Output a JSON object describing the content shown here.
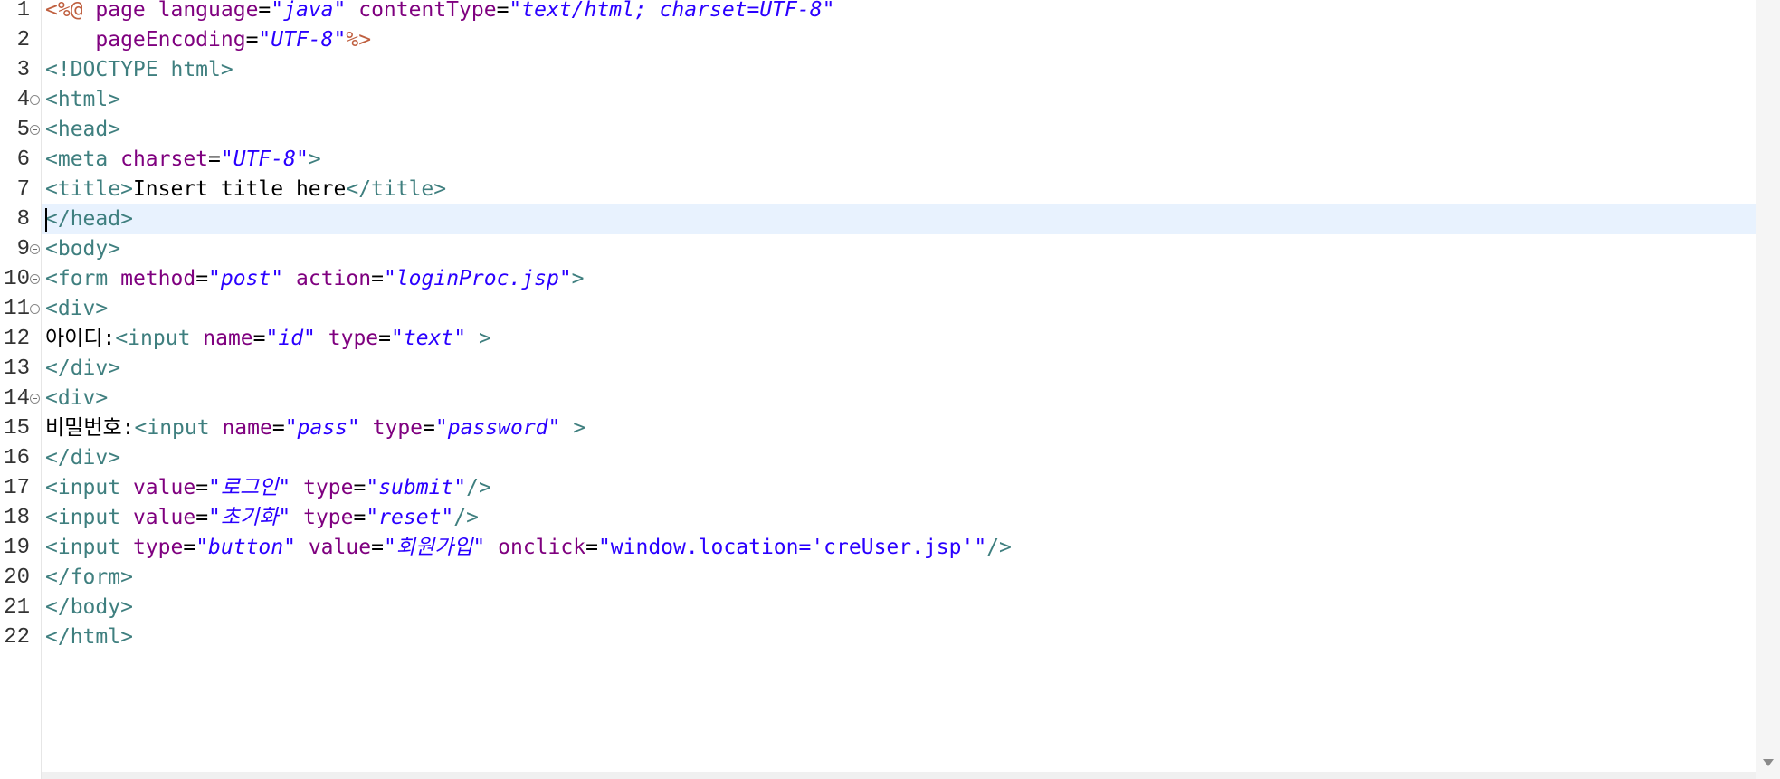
{
  "editor": {
    "current_line": 8,
    "lines": [
      {
        "n": "1",
        "fold": false,
        "tokens": [
          [
            "jsp",
            "<%@ "
          ],
          [
            "attr",
            "page "
          ],
          [
            "attr",
            "language"
          ],
          [
            "text",
            "="
          ],
          [
            "str",
            "\"java\""
          ],
          [
            "text",
            " "
          ],
          [
            "attr",
            "contentType"
          ],
          [
            "text",
            "="
          ],
          [
            "str",
            "\"text/html; charset=UTF-8\""
          ]
        ]
      },
      {
        "n": "2",
        "fold": false,
        "tokens": [
          [
            "text",
            "    "
          ],
          [
            "attr",
            "pageEncoding"
          ],
          [
            "text",
            "="
          ],
          [
            "str",
            "\"UTF-8\""
          ],
          [
            "jsp",
            "%>"
          ]
        ]
      },
      {
        "n": "3",
        "fold": false,
        "tokens": [
          [
            "tag",
            "<!DOCTYPE html>"
          ]
        ]
      },
      {
        "n": "4",
        "fold": true,
        "tokens": [
          [
            "tag",
            "<html>"
          ]
        ]
      },
      {
        "n": "5",
        "fold": true,
        "tokens": [
          [
            "tag",
            "<head>"
          ]
        ]
      },
      {
        "n": "6",
        "fold": false,
        "tokens": [
          [
            "tag",
            "<meta "
          ],
          [
            "attr",
            "charset"
          ],
          [
            "text",
            "="
          ],
          [
            "str",
            "\"UTF-8\""
          ],
          [
            "tag",
            ">"
          ]
        ]
      },
      {
        "n": "7",
        "fold": false,
        "tokens": [
          [
            "tag",
            "<title>"
          ],
          [
            "text",
            "Insert title here"
          ],
          [
            "tag",
            "</title>"
          ]
        ]
      },
      {
        "n": "8",
        "fold": false,
        "tokens": [
          [
            "tag",
            "</head>"
          ]
        ]
      },
      {
        "n": "9",
        "fold": true,
        "tokens": [
          [
            "tag",
            "<body>"
          ]
        ]
      },
      {
        "n": "10",
        "fold": true,
        "tokens": [
          [
            "tag",
            "<form "
          ],
          [
            "attr",
            "method"
          ],
          [
            "text",
            "="
          ],
          [
            "str",
            "\"post\""
          ],
          [
            "text",
            " "
          ],
          [
            "attr",
            "action"
          ],
          [
            "text",
            "="
          ],
          [
            "str",
            "\"loginProc.jsp\""
          ],
          [
            "tag",
            ">"
          ]
        ]
      },
      {
        "n": "11",
        "fold": true,
        "tokens": [
          [
            "tag",
            "<div>"
          ]
        ]
      },
      {
        "n": "12",
        "fold": false,
        "tokens": [
          [
            "text",
            "아이디:"
          ],
          [
            "tag",
            "<input "
          ],
          [
            "attr",
            "name"
          ],
          [
            "text",
            "="
          ],
          [
            "str",
            "\"id\""
          ],
          [
            "text",
            " "
          ],
          [
            "attr",
            "type"
          ],
          [
            "text",
            "="
          ],
          [
            "str",
            "\"text\""
          ],
          [
            "text",
            " "
          ],
          [
            "tag",
            ">"
          ]
        ]
      },
      {
        "n": "13",
        "fold": false,
        "tokens": [
          [
            "tag",
            "</div>"
          ]
        ]
      },
      {
        "n": "14",
        "fold": true,
        "tokens": [
          [
            "tag",
            "<div>"
          ]
        ]
      },
      {
        "n": "15",
        "fold": false,
        "tokens": [
          [
            "text",
            "비밀번호:"
          ],
          [
            "tag",
            "<input "
          ],
          [
            "attr",
            "name"
          ],
          [
            "text",
            "="
          ],
          [
            "str",
            "\"pass\""
          ],
          [
            "text",
            " "
          ],
          [
            "attr",
            "type"
          ],
          [
            "text",
            "="
          ],
          [
            "str",
            "\"password\""
          ],
          [
            "text",
            " "
          ],
          [
            "tag",
            ">"
          ]
        ]
      },
      {
        "n": "16",
        "fold": false,
        "tokens": [
          [
            "tag",
            "</div>"
          ]
        ]
      },
      {
        "n": "17",
        "fold": false,
        "tokens": [
          [
            "tag",
            "<input "
          ],
          [
            "attr",
            "value"
          ],
          [
            "text",
            "="
          ],
          [
            "str",
            "\"로그인\""
          ],
          [
            "text",
            " "
          ],
          [
            "attr",
            "type"
          ],
          [
            "text",
            "="
          ],
          [
            "str",
            "\"submit\""
          ],
          [
            "tag",
            "/>"
          ]
        ]
      },
      {
        "n": "18",
        "fold": false,
        "tokens": [
          [
            "tag",
            "<input "
          ],
          [
            "attr",
            "value"
          ],
          [
            "text",
            "="
          ],
          [
            "str",
            "\"초기화\""
          ],
          [
            "text",
            " "
          ],
          [
            "attr",
            "type"
          ],
          [
            "text",
            "="
          ],
          [
            "str",
            "\"reset\""
          ],
          [
            "tag",
            "/>"
          ]
        ]
      },
      {
        "n": "19",
        "fold": false,
        "tokens": [
          [
            "tag",
            "<input "
          ],
          [
            "attr",
            "type"
          ],
          [
            "text",
            "="
          ],
          [
            "str",
            "\"button\""
          ],
          [
            "text",
            " "
          ],
          [
            "attr",
            "value"
          ],
          [
            "text",
            "="
          ],
          [
            "str",
            "\"회원가입\""
          ],
          [
            "text",
            " "
          ],
          [
            "attr",
            "onclick"
          ],
          [
            "text",
            "="
          ],
          [
            "jsstr",
            "\"window.location='creUser.jsp'\""
          ],
          [
            "tag",
            "/>"
          ]
        ]
      },
      {
        "n": "20",
        "fold": false,
        "tokens": [
          [
            "tag",
            "</form>"
          ]
        ]
      },
      {
        "n": "21",
        "fold": false,
        "tokens": [
          [
            "tag",
            "</body>"
          ]
        ]
      },
      {
        "n": "22",
        "fold": false,
        "tokens": [
          [
            "tag",
            "</html>"
          ]
        ]
      }
    ]
  }
}
